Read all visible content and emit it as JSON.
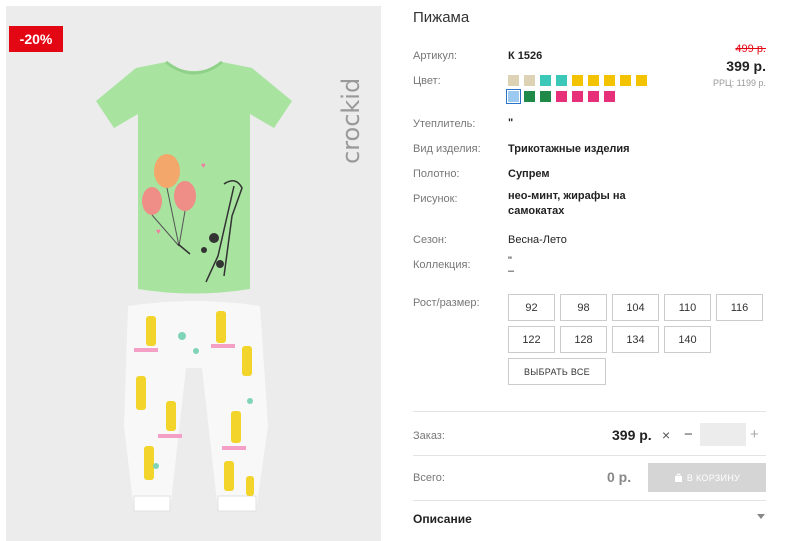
{
  "discount_badge": "-20%",
  "brand": "crockid",
  "product": {
    "title": "Пижама",
    "old_price": "499 р.",
    "price": "399 р.",
    "rrp": "РРЦ: 1199 р."
  },
  "attributes": [
    {
      "label": "Артикул:",
      "value": "К 1526"
    },
    {
      "label": "Цвет:",
      "value": ""
    },
    {
      "label": "Утеплитель:",
      "value": "\""
    },
    {
      "label": "Вид изделия:",
      "value": "Трикотажные изделия"
    },
    {
      "label": "Полотно:",
      "value": "Супрем"
    },
    {
      "label": "Рисунок:",
      "value": "нео-минт, жирафы на самокатах"
    },
    {
      "label": "Сезон:",
      "value": "Весна-Лето"
    },
    {
      "label": "Коллекция:",
      "value": "\"\n–"
    }
  ],
  "colors": {
    "row1": [
      "#ddd2b3",
      "#ddd2b3",
      "#3cc8b8",
      "#3cc8b8",
      "#f4c300",
      "#f4c300",
      "#f4c300",
      "#f4c300",
      "#f4c300"
    ],
    "row2": [
      "#9cc9ef",
      "#1f8a48",
      "#1f8a48",
      "#e8307a",
      "#e8307a",
      "#e8307a",
      "#e8307a"
    ],
    "selected": "row2.0",
    "accent_red": "#e30613"
  },
  "sizes": {
    "label": "Рост/размер:",
    "row1": [
      "92",
      "98",
      "104",
      "110",
      "116"
    ],
    "row2": [
      "122",
      "128",
      "134",
      "140"
    ],
    "select_all": "ВЫБРАТЬ ВСЕ"
  },
  "order": {
    "label": "Заказ:",
    "price": "399 р.",
    "remove_icon": "×",
    "minus": "−",
    "plus": "+",
    "quantity": ""
  },
  "total": {
    "label": "Всего:",
    "value": "0 р.",
    "cart_button": "В КОРЗИНУ"
  },
  "description": {
    "label": "Описание"
  }
}
